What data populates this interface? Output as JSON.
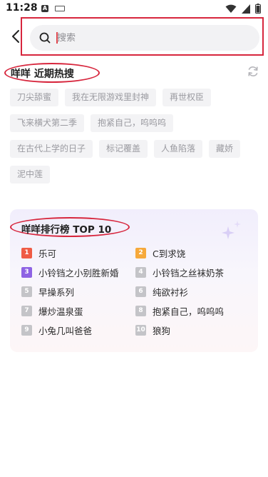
{
  "status_bar": {
    "time": "11:28",
    "notification_badge": "A",
    "icons": [
      "wifi-icon",
      "signal-icon",
      "battery-icon"
    ]
  },
  "search": {
    "placeholder": "搜索"
  },
  "hot_search": {
    "title": "咩咩 近期热搜",
    "tags": [
      "刀尖舔蜜",
      "我在无限游戏里封神",
      "再世权臣",
      "飞来横犬第二季",
      "抱紧自己，呜呜呜",
      "在古代上学的日子",
      "标记覆盖",
      "人鱼陷落",
      "藏娇",
      "泥中莲"
    ]
  },
  "ranking": {
    "title": "咩咩排行榜 TOP 10",
    "items": [
      {
        "rank": "1",
        "label": "乐可",
        "color": "#ef5b45"
      },
      {
        "rank": "2",
        "label": "C到求饶",
        "color": "#f6a93b"
      },
      {
        "rank": "3",
        "label": "小铃铛之小别胜新婚",
        "color": "#8e63e4"
      },
      {
        "rank": "4",
        "label": "小铃铛之丝袜奶茶",
        "color": "#c4c4c8"
      },
      {
        "rank": "5",
        "label": "早操系列",
        "color": "#c4c4c8"
      },
      {
        "rank": "6",
        "label": "纯欲衬衫",
        "color": "#c4c4c8"
      },
      {
        "rank": "7",
        "label": "爆炒温泉蛋",
        "color": "#c4c4c8"
      },
      {
        "rank": "8",
        "label": "抱紧自己，呜呜呜",
        "color": "#c4c4c8"
      },
      {
        "rank": "9",
        "label": "小兔几叫爸爸",
        "color": "#c4c4c8"
      },
      {
        "rank": "10",
        "label": "狼狗",
        "color": "#c4c4c8"
      }
    ]
  },
  "colors": {
    "highlight_red": "#d7263d",
    "tag_bg": "#f3f3f5",
    "tag_text": "#9a9aa0"
  }
}
